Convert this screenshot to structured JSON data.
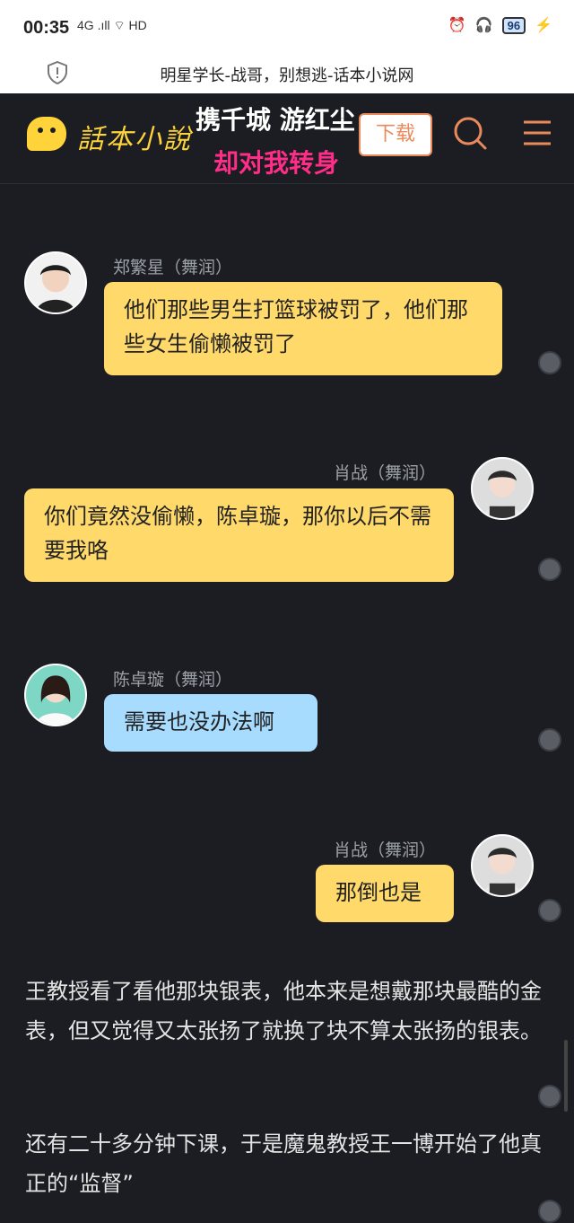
{
  "status": {
    "time": "00:35",
    "net": "4G .ıll",
    "hd": "HD",
    "battery": "96"
  },
  "urlbar": {
    "title": "明星学长-战哥，别想逃-话本小说网"
  },
  "header": {
    "logo": "話本小說",
    "overlay_line1": "携千城 游红尘",
    "overlay_line2": "却对我转身",
    "download": "下载"
  },
  "chat": [
    {
      "name": "郑繁星（舞润）",
      "text": "他们那些男生打篮球被罚了，他们那些女生偷懒被罚了"
    },
    {
      "name": "肖战（舞润）",
      "text": "你们竟然没偷懒，陈卓璇，那你以后不需要我咯"
    },
    {
      "name": "陈卓璇（舞润）",
      "text": "需要也没办法啊"
    },
    {
      "name": "肖战（舞润）",
      "text": "那倒也是"
    }
  ],
  "narration": [
    "王教授看了看他那块银表，他本来是想戴那块最酷的金表，但又觉得又太张扬了就换了块不算太张扬的银表。",
    "还有二十多分钟下课，于是魔鬼教授王一博开始了他真正的“监督”"
  ],
  "colors": {
    "bg": "#1b1d22",
    "yellow_bubble": "#ffd96a",
    "blue_bubble": "#a8dcff",
    "accent": "#ff2d88",
    "download": "#e88a5b"
  }
}
